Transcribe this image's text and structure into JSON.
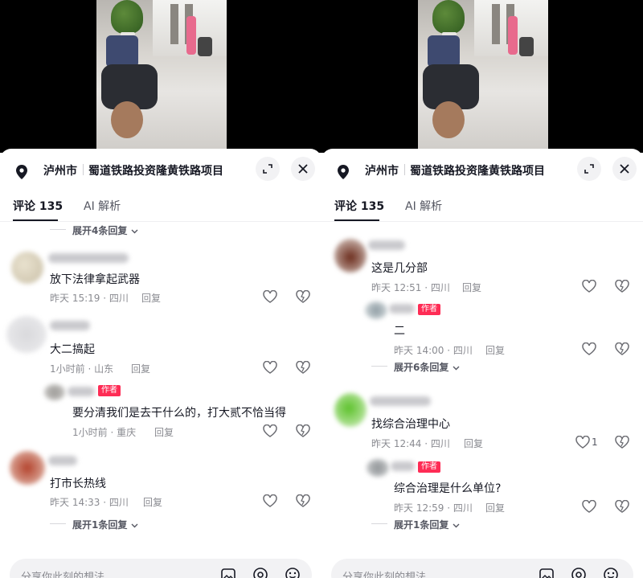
{
  "panels": [
    {
      "location": {
        "city": "泸州市",
        "name": "蜀道铁路投资隆黄铁路项目"
      },
      "tabs": {
        "comments": "评论 135",
        "ai": "AI 解析"
      },
      "top_expand": "展开4条回复",
      "comments": [
        {
          "text": "放下法律拿起武器",
          "meta": "昨天 15:19 · 四川",
          "reply": "回复"
        },
        {
          "text": "大二搞起",
          "meta": "1小时前 · 山东",
          "reply": "回复"
        },
        {
          "text": "要分清我们是去干什么的，打大贰不恰当得",
          "meta": "1小时前 · 重庆",
          "reply": "回复",
          "badge": "作者"
        },
        {
          "text": "打市长热线",
          "meta": "昨天 14:33 · 四川",
          "reply": "回复"
        }
      ],
      "bottom_expand": "展开1条回复",
      "input_placeholder": "分享你此刻的想法"
    },
    {
      "location": {
        "city": "泸州市",
        "name": "蜀道铁路投资隆黄铁路项目"
      },
      "tabs": {
        "comments": "评论 135",
        "ai": "AI 解析"
      },
      "comments": [
        {
          "text": "这是几分部",
          "meta": "昨天 12:51 · 四川",
          "reply": "回复"
        },
        {
          "text": "二",
          "meta": "昨天 14:00 · 四川",
          "reply": "回复",
          "badge": "作者"
        },
        {
          "text": "找综合治理中心",
          "meta": "昨天 12:44 · 四川",
          "reply": "回复",
          "likes": "1"
        },
        {
          "text": "综合治理是什么单位?",
          "meta": "昨天 12:59 · 四川",
          "reply": "回复",
          "badge": "作者"
        }
      ],
      "mid_expand": "展开6条回复",
      "bottom_expand": "展开1条回复",
      "input_placeholder": "分享你此刻的想法"
    }
  ],
  "colors": {
    "accent": "#fe2c55",
    "text": "#161823",
    "meta": "#8a8b91"
  },
  "icons": [
    "location-pin-icon",
    "collapse-icon",
    "close-icon",
    "like-icon",
    "dislike-icon",
    "image-icon",
    "mention-icon",
    "emoji-icon",
    "chevron-down-icon"
  ]
}
